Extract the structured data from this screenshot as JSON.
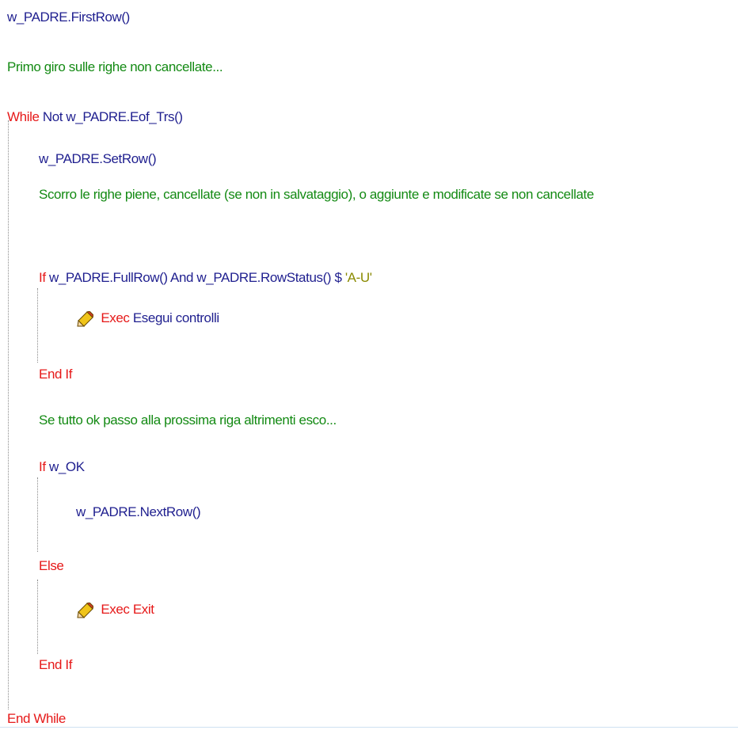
{
  "code": {
    "first_row": "w_PADRE.FirstRow()",
    "comment_first_loop": "Primo giro sulle righe non cancellate...",
    "while_keyword": "While",
    "while_condition": "Not w_PADRE.Eof_Trs()",
    "set_row": "w_PADRE.SetRow()",
    "comment_scroll": "Scorro le righe piene, cancellate (se non in salvataggio), o aggiunte e modificate se non cancellate",
    "if1_keyword": "If",
    "if1_condition": "w_PADRE.FullRow() And  w_PADRE.RowStatus() $",
    "if1_string": "'A-U'",
    "exec1_keyword": "Exec",
    "exec1_target": "Esegui controlli",
    "end_if1": "End If",
    "comment_next": "Se tutto ok passo alla prossima riga altrimenti esco...",
    "if2_keyword": "If",
    "if2_condition": "w_OK",
    "next_row": "w_PADRE.NextRow()",
    "else_keyword": "Else",
    "exec2_keyword": "Exec",
    "exec2_target": "Exit",
    "end_if2": "End If",
    "end_while": "End While"
  },
  "colors": {
    "statement": "#1f1f8f",
    "comment": "#138a13",
    "keyword": "#e61919",
    "string": "#8a8a00"
  },
  "icons": {
    "exec": "pencil-icon"
  }
}
